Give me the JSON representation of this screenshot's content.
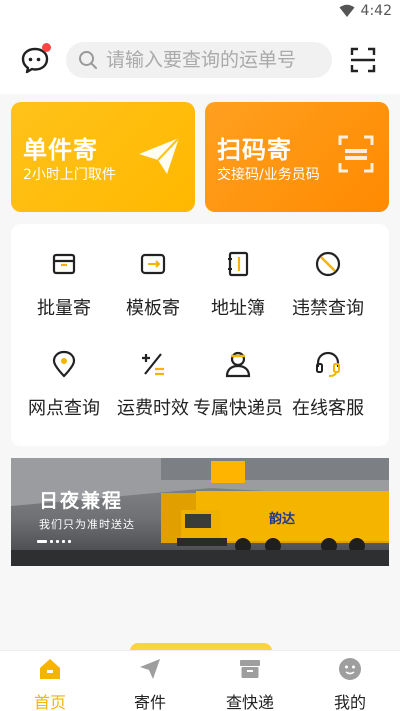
{
  "status_bar": {
    "time": "4:42"
  },
  "header": {
    "search_placeholder": "请输入要查询的运单号"
  },
  "actions": [
    {
      "title": "单件寄",
      "subtitle": "2小时上门取件",
      "icon": "paper-plane-icon"
    },
    {
      "title": "扫码寄",
      "subtitle": "交接码/业务员码",
      "icon": "scan-code-icon"
    }
  ],
  "services": [
    {
      "label": "批量寄",
      "icon": "box-icon"
    },
    {
      "label": "模板寄",
      "icon": "template-icon"
    },
    {
      "label": "地址簿",
      "icon": "address-book-icon"
    },
    {
      "label": "违禁查询",
      "icon": "prohibited-icon"
    },
    {
      "label": "网点查询",
      "icon": "location-pin-icon"
    },
    {
      "label": "运费时效",
      "icon": "calculator-icon"
    },
    {
      "label": "专属快递员",
      "icon": "courier-icon"
    },
    {
      "label": "在线客服",
      "icon": "headset-icon"
    }
  ],
  "banner": {
    "title": "日夜兼程",
    "subtitle": "我们只为准时送达",
    "truck_brand": "韵达",
    "slide_count": 5,
    "active_slide": 1
  },
  "tabs": [
    {
      "label": "首页",
      "icon": "home-icon",
      "active": true
    },
    {
      "label": "寄件",
      "icon": "send-icon",
      "active": false
    },
    {
      "label": "查快递",
      "icon": "package-icon",
      "active": false
    },
    {
      "label": "我的",
      "icon": "profile-icon",
      "active": false
    }
  ],
  "colors": {
    "accent": "#FFC21A",
    "orange": "#FF8A00",
    "tab_active": "#F5B400"
  }
}
